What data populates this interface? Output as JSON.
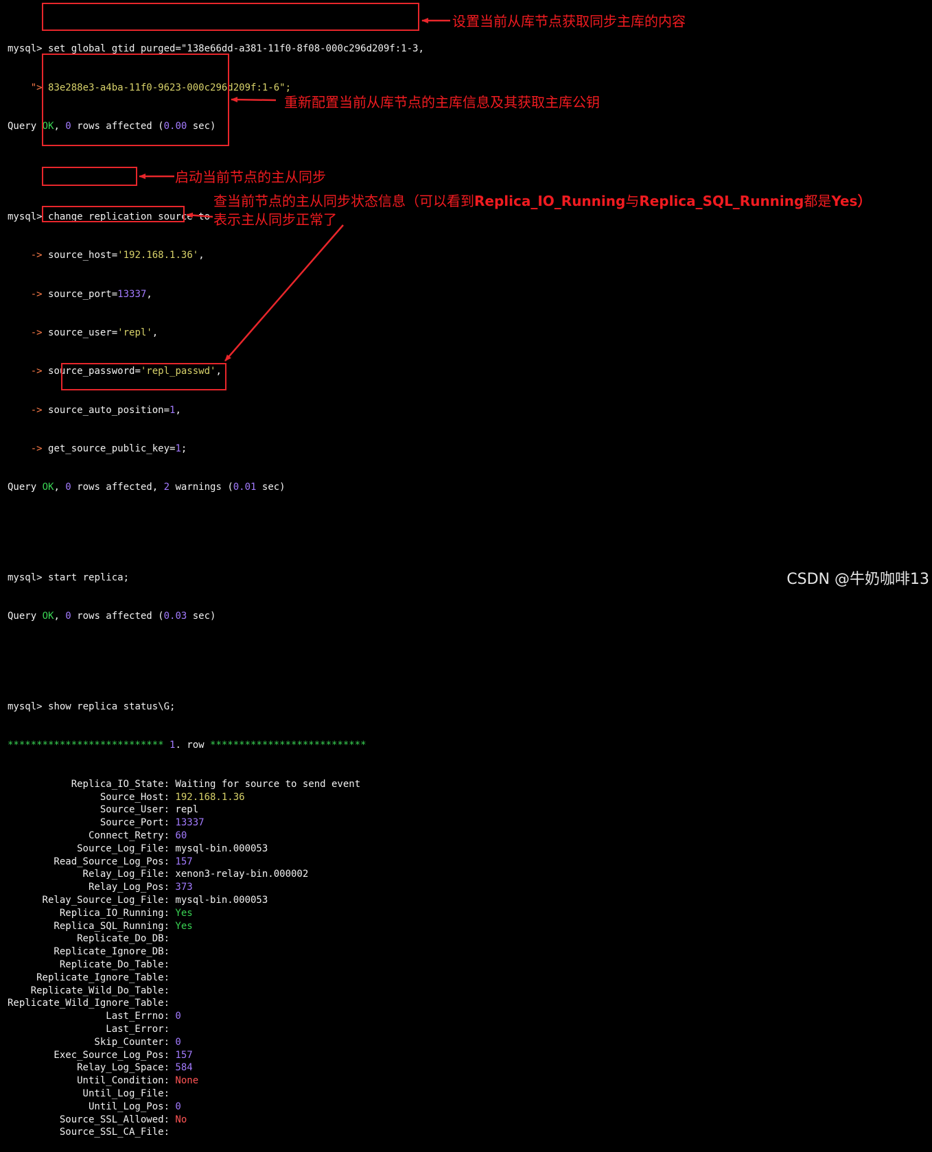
{
  "terminal": {
    "prompt": "mysql>",
    "cont_prompt": "->",
    "quote_prompt": "\">",
    "cmd1": {
      "line1": "set global gtid_purged=\"138e66dd-a381-11f0-8f08-000c296d209f:1-3,",
      "line2": "83e288e3-a4ba-11f0-9623-000c296d209f:1-6\";",
      "result": {
        "q": "Query ",
        "ok": "OK",
        "mid1": ", ",
        "rows": "0",
        "mid2": " rows affected (",
        "time": "0.00",
        "end": " sec)"
      }
    },
    "cmd2": {
      "line1": "change replication source to",
      "host_key": "source_host=",
      "host_val": "'192.168.1.36'",
      "port_key": "source_port=",
      "port_val": "13337",
      "user_key": "source_user=",
      "user_val": "'repl'",
      "pwd_key": "source_password=",
      "pwd_val": "'repl_passwd'",
      "auto_key": "source_auto_position=",
      "auto_val": "1",
      "pk_key": "get_source_public_key=",
      "pk_val": "1",
      "result": {
        "q": "Query ",
        "ok": "OK",
        "mid1": ", ",
        "rows": "0",
        "mid2": " rows affected, ",
        "warn": "2",
        "mid3": " warnings (",
        "time": "0.01",
        "end": " sec)"
      }
    },
    "cmd3": {
      "line1": "start replica;",
      "result": {
        "q": "Query ",
        "ok": "OK",
        "mid1": ", ",
        "rows": "0",
        "mid2": " rows affected (",
        "time": "0.03",
        "end": " sec)"
      }
    },
    "cmd4": {
      "line1": "show replica status\\G;"
    },
    "row_header": {
      "stars1": "***************************",
      "num": " 1",
      "mid": ". row ",
      "stars2": "***************************"
    },
    "status": [
      {
        "key": "Replica_IO_State",
        "value": "Waiting for source to send event",
        "color": "#f2f2f2"
      },
      {
        "key": "Source_Host",
        "value": "192.168.1.36",
        "color": "#d8d26a"
      },
      {
        "key": "Source_User",
        "value": "repl",
        "color": "#f2f2f2"
      },
      {
        "key": "Source_Port",
        "value": "13337",
        "color": "#a37bff"
      },
      {
        "key": "Connect_Retry",
        "value": "60",
        "color": "#a37bff"
      },
      {
        "key": "Source_Log_File",
        "value": "mysql-bin.000053",
        "color": "#f2f2f2"
      },
      {
        "key": "Read_Source_Log_Pos",
        "value": "157",
        "color": "#a37bff"
      },
      {
        "key": "Relay_Log_File",
        "value": "xenon3-relay-bin.000002",
        "color": "#f2f2f2"
      },
      {
        "key": "Relay_Log_Pos",
        "value": "373",
        "color": "#a37bff"
      },
      {
        "key": "Relay_Source_Log_File",
        "value": "mysql-bin.000053",
        "color": "#f2f2f2"
      },
      {
        "key": "Replica_IO_Running",
        "value": "Yes",
        "color": "#39d353"
      },
      {
        "key": "Replica_SQL_Running",
        "value": "Yes",
        "color": "#39d353"
      },
      {
        "key": "Replicate_Do_DB",
        "value": "",
        "color": "#f2f2f2"
      },
      {
        "key": "Replicate_Ignore_DB",
        "value": "",
        "color": "#f2f2f2"
      },
      {
        "key": "Replicate_Do_Table",
        "value": "",
        "color": "#f2f2f2"
      },
      {
        "key": "Replicate_Ignore_Table",
        "value": "",
        "color": "#f2f2f2"
      },
      {
        "key": "Replicate_Wild_Do_Table",
        "value": "",
        "color": "#f2f2f2"
      },
      {
        "key": "Replicate_Wild_Ignore_Table",
        "value": "",
        "color": "#f2f2f2"
      },
      {
        "key": "Last_Errno",
        "value": "0",
        "color": "#a37bff"
      },
      {
        "key": "Last_Error",
        "value": "",
        "color": "#f2f2f2"
      },
      {
        "key": "Skip_Counter",
        "value": "0",
        "color": "#a37bff"
      },
      {
        "key": "Exec_Source_Log_Pos",
        "value": "157",
        "color": "#a37bff"
      },
      {
        "key": "Relay_Log_Space",
        "value": "584",
        "color": "#a37bff"
      },
      {
        "key": "Until_Condition",
        "value": "None",
        "color": "#ff5555"
      },
      {
        "key": "Until_Log_File",
        "value": "",
        "color": "#f2f2f2"
      },
      {
        "key": "Until_Log_Pos",
        "value": "0",
        "color": "#a37bff"
      },
      {
        "key": "Source_SSL_Allowed",
        "value": "No",
        "color": "#ff5555"
      },
      {
        "key": "Source_SSL_CA_File",
        "value": "",
        "color": "#f2f2f2"
      }
    ]
  },
  "annotations": {
    "a1": "设置当前从库节点获取同步主库的内容",
    "a2": "重新配置当前从库节点的主库信息及其获取主库公钥",
    "a3": "启动当前节点的主从同步",
    "a4_pre": "查当前节点的主从同步状态信息（可以看到",
    "a4_k1": "Replica_IO_Running",
    "a4_mid": "与",
    "a4_k2": "Replica_SQL_Running",
    "a4_mid2": "都是",
    "a4_yes": "Yes",
    "a4_end": "）",
    "a5": "表示主从同步正常了"
  },
  "colors": {
    "background": "#000000",
    "text": "#f2f2f2",
    "ok_green": "#39d353",
    "number_purple": "#a37bff",
    "string_yellow": "#d8d26a",
    "keyword_red": "#ff5555",
    "annotation_red": "#f01b20"
  },
  "watermark": "CSDN @牛奶咖啡13"
}
